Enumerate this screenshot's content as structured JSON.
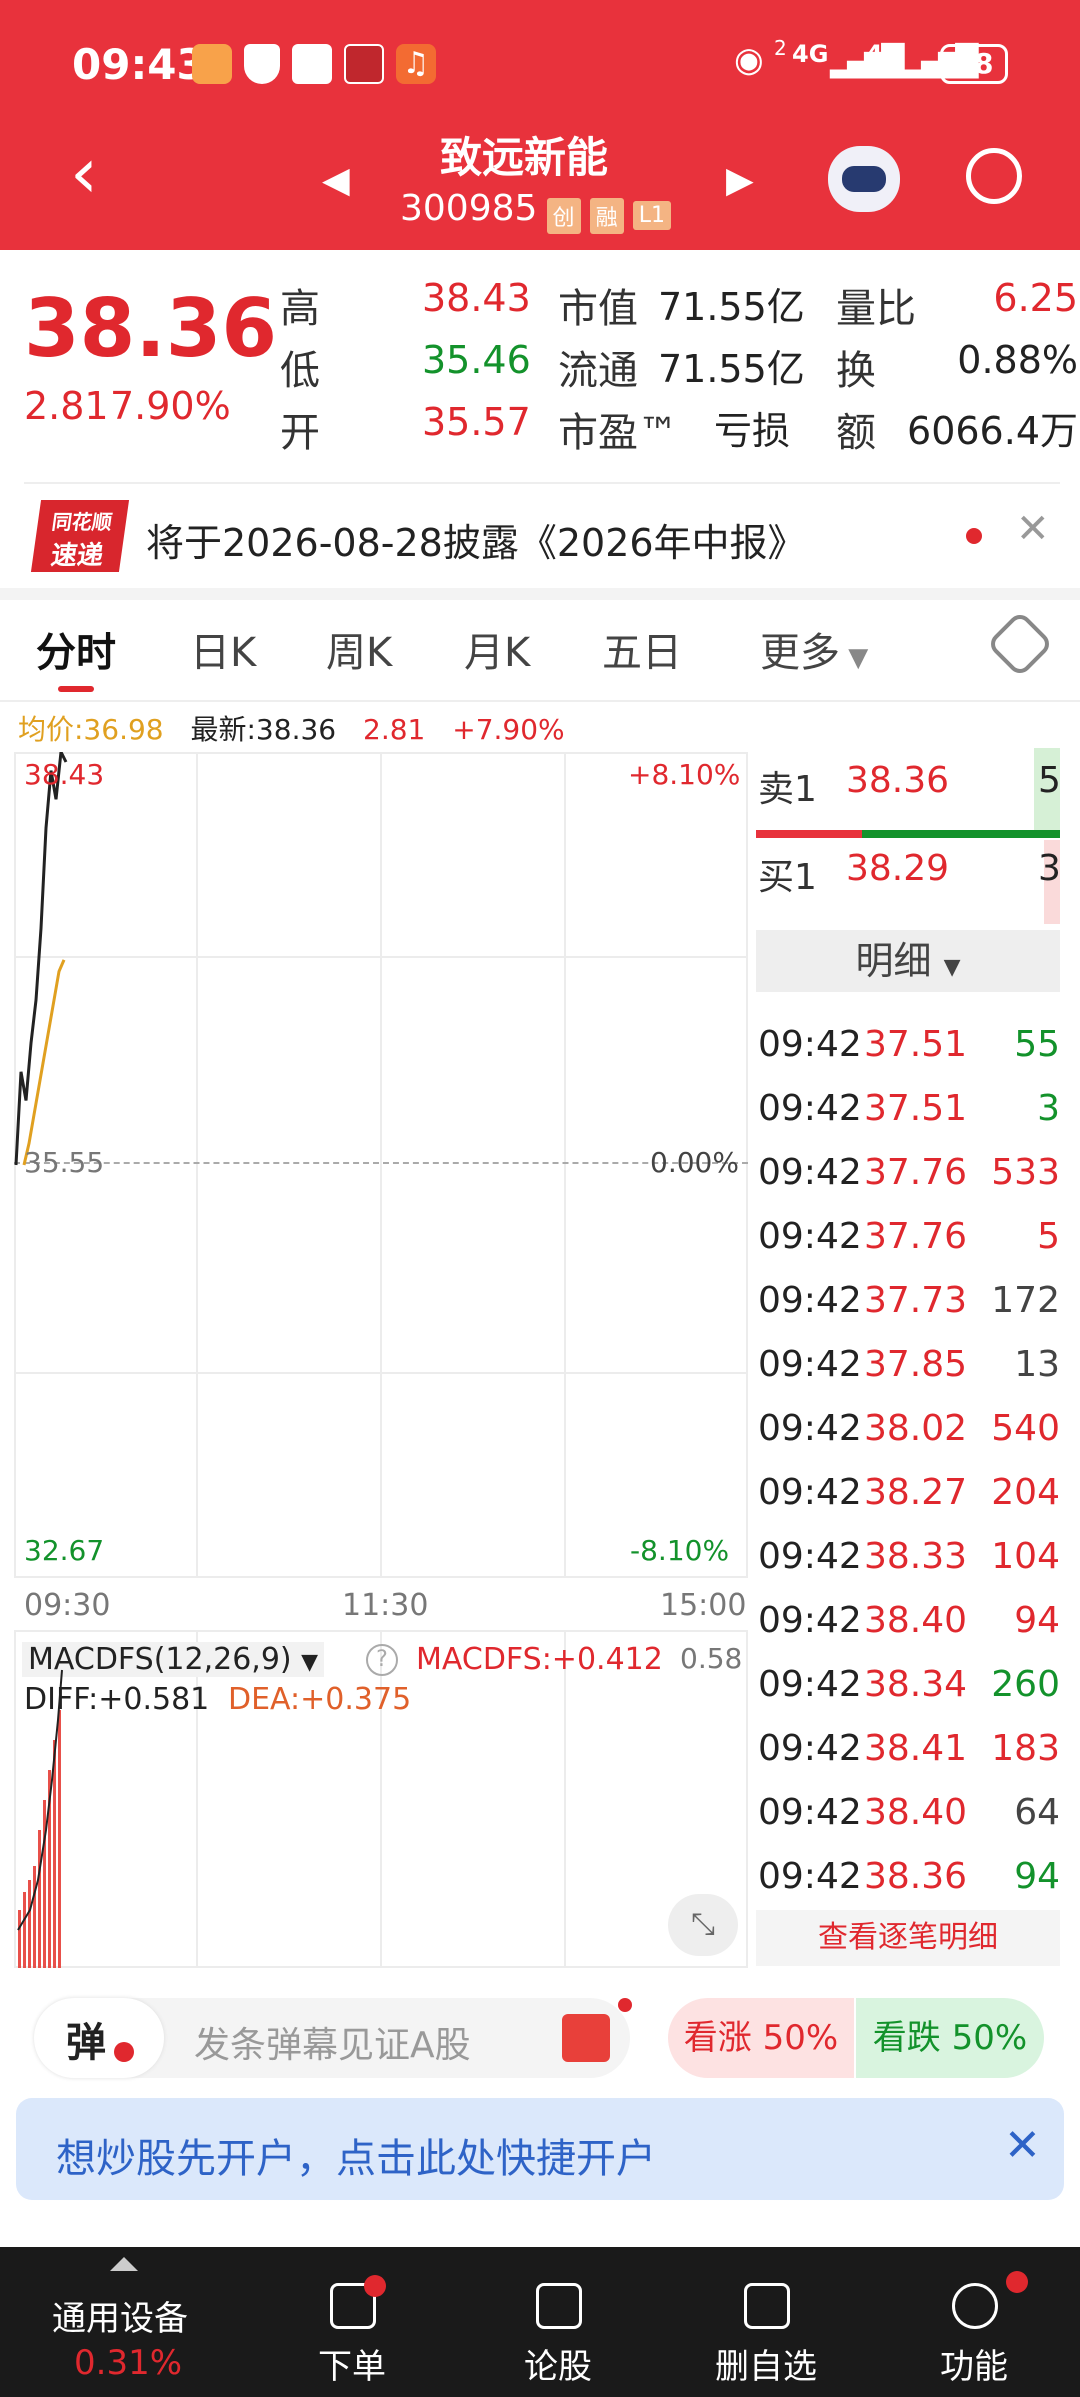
{
  "status": {
    "time": "09:43",
    "battery": "48",
    "net1": "4G",
    "net2": "4G",
    "sim": "2"
  },
  "header": {
    "title": "致远新能",
    "code": "300985",
    "badges": [
      "创",
      "融",
      "L1"
    ]
  },
  "quote": {
    "price": "38.36",
    "change": "2.81",
    "change_pct": "7.90%",
    "high_label": "高",
    "high": "38.43",
    "low_label": "低",
    "low": "35.46",
    "open_label": "开",
    "open": "35.57",
    "mktcap_label": "市值",
    "mktcap": "71.55亿",
    "float_label": "流通",
    "float": "71.55亿",
    "pe_label": "市盈™",
    "pe": "亏损",
    "volratio_label": "量比",
    "volratio": "6.25",
    "turnover_label": "换",
    "turnover": "0.88%",
    "amount_label": "额",
    "amount": "6066.4万"
  },
  "notice": {
    "logo_top": "同花顺",
    "logo_bottom": "速递",
    "text": "将于2026-08-28披露《2026年中报》"
  },
  "tabs": [
    "分时",
    "日K",
    "周K",
    "月K",
    "五日",
    "更多"
  ],
  "info_line": {
    "avg": "均价:36.98",
    "latest": "最新:38.36",
    "chg": "2.81",
    "pct": "+7.90%"
  },
  "chart_labels": {
    "top_price": "38.43",
    "top_pct": "+8.10%",
    "mid_price": "35.55",
    "mid_pct": "0.00%",
    "bot_price": "32.67",
    "bot_pct": "-8.10%",
    "t_start": "09:30",
    "t_mid": "11:30",
    "t_end": "15:00"
  },
  "chart_data": {
    "type": "line",
    "series": [
      {
        "values": [
          35.55,
          36.2,
          36.0,
          36.4,
          36.7,
          37.2,
          37.9,
          38.3,
          38.1,
          38.43,
          38.36
        ]
      },
      {
        "values": [
          35.55,
          35.7,
          35.9,
          36.1,
          36.3,
          36.5,
          36.7,
          36.9,
          36.98
        ]
      }
    ],
    "ylim": [
      32.67,
      38.43
    ]
  },
  "orderbook": {
    "sell_label": "卖1",
    "sell_price": "38.36",
    "sell_vol": "5",
    "buy_label": "买1",
    "buy_price": "38.29",
    "buy_vol": "3",
    "detail_label": "明细"
  },
  "trades": [
    {
      "time": "09:42",
      "price": "37.51",
      "vol": "55",
      "vc": "green"
    },
    {
      "time": "09:42",
      "price": "37.51",
      "vol": "3",
      "vc": "green"
    },
    {
      "time": "09:42",
      "price": "37.76",
      "vol": "533",
      "vc": "red"
    },
    {
      "time": "09:42",
      "price": "37.76",
      "vol": "5",
      "vc": "red"
    },
    {
      "time": "09:42",
      "price": "37.73",
      "vol": "172",
      "vc": "gray"
    },
    {
      "time": "09:42",
      "price": "37.85",
      "vol": "13",
      "vc": "gray"
    },
    {
      "time": "09:42",
      "price": "38.02",
      "vol": "540",
      "vc": "red"
    },
    {
      "time": "09:42",
      "price": "38.27",
      "vol": "204",
      "vc": "red"
    },
    {
      "time": "09:42",
      "price": "38.33",
      "vol": "104",
      "vc": "red"
    },
    {
      "time": "09:42",
      "price": "38.40",
      "vol": "94",
      "vc": "red"
    },
    {
      "time": "09:42",
      "price": "38.34",
      "vol": "260",
      "vc": "green"
    },
    {
      "time": "09:42",
      "price": "38.41",
      "vol": "183",
      "vc": "red"
    },
    {
      "time": "09:42",
      "price": "38.40",
      "vol": "64",
      "vc": "gray"
    },
    {
      "time": "09:42",
      "price": "38.36",
      "vol": "94",
      "vc": "green"
    }
  ],
  "trade_more": "查看逐笔明细",
  "macd": {
    "name": "MACDFS(12,26,9)",
    "value": "MACDFS:+0.412",
    "diff": "DIFF:+0.581",
    "dea": "DEA:+0.375",
    "scale": "0.58"
  },
  "danmu": {
    "btn": "弹",
    "placeholder": "发条弹幕见证A股",
    "up": "看涨 50%",
    "down": "看跌 50%"
  },
  "banner": {
    "text": "想炒股先开户，点击此处快捷开户"
  },
  "bottom_nav": {
    "device": "通用设备",
    "device_pct": "0.31%",
    "items": [
      "下单",
      "论股",
      "删自选",
      "功能"
    ]
  }
}
